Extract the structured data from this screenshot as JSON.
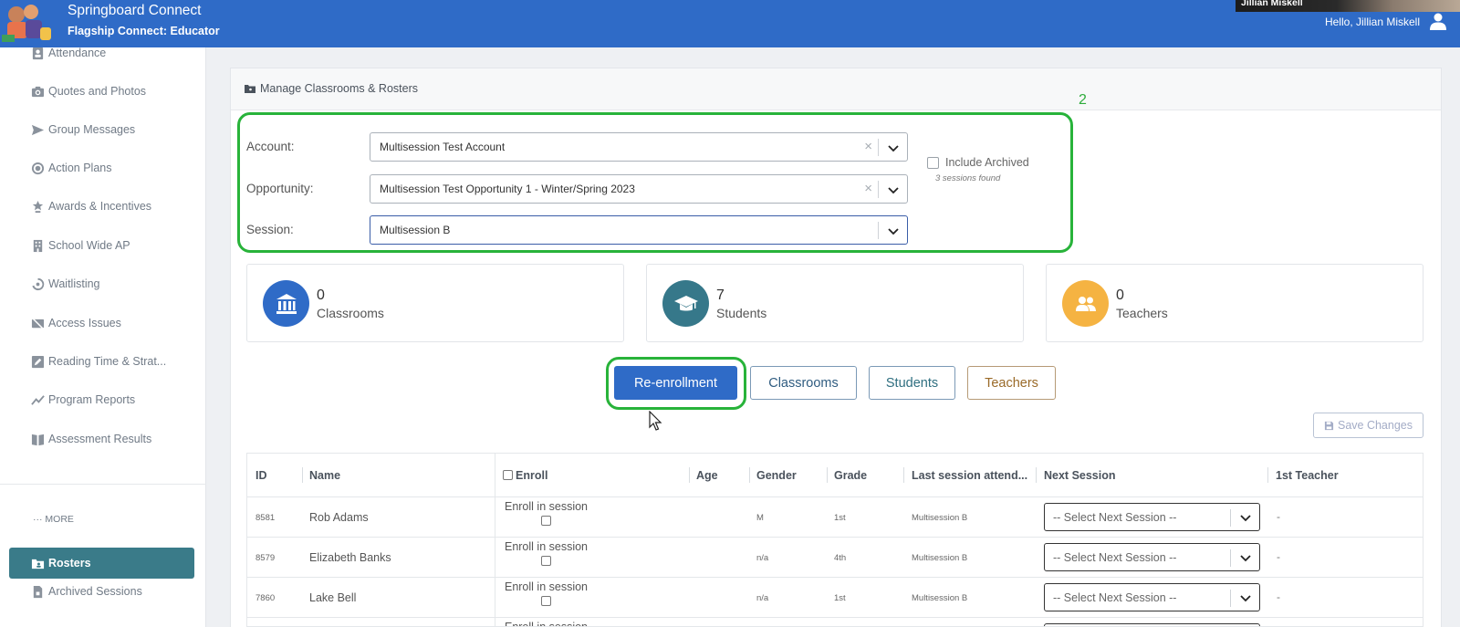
{
  "header": {
    "app_title": "Springboard Connect",
    "app_subtitle": "Flagship Connect: Educator",
    "greeting": "Hello, Jillian Miskell",
    "video_participant": "Jillian Miskell"
  },
  "sidebar": {
    "items": [
      {
        "label": "Attendance",
        "icon": "attendance-icon"
      },
      {
        "label": "Quotes and Photos",
        "icon": "camera-icon"
      },
      {
        "label": "Group Messages",
        "icon": "send-icon"
      },
      {
        "label": "Action Plans",
        "icon": "target-icon"
      },
      {
        "label": "Awards & Incentives",
        "icon": "award-icon"
      },
      {
        "label": "School Wide AP",
        "icon": "building-icon"
      },
      {
        "label": "Waitlisting",
        "icon": "waitlist-icon"
      },
      {
        "label": "Access Issues",
        "icon": "access-icon"
      },
      {
        "label": "Reading Time & Strat...",
        "icon": "edit-icon"
      },
      {
        "label": "Program Reports",
        "icon": "chart-line-icon"
      },
      {
        "label": "Assessment Results",
        "icon": "book-icon"
      }
    ],
    "more_label": "··· MORE",
    "active_item": "Rosters",
    "archived_sessions": "Archived Sessions"
  },
  "card": {
    "title": "Manage Classrooms & Rosters",
    "annotation_number": "2"
  },
  "filters": {
    "account_label": "Account:",
    "account_value": "Multisession Test Account",
    "opportunity_label": "Opportunity:",
    "opportunity_value": "Multisession Test Opportunity 1 - Winter/Spring 2023",
    "session_label": "Session:",
    "session_value": "Multisession B",
    "include_archived_label": "Include Archived",
    "sessions_found": "3 sessions found"
  },
  "stats": {
    "classrooms": {
      "count": "0",
      "label": "Classrooms",
      "color": "#2f6bc7"
    },
    "students": {
      "count": "7",
      "label": "Students",
      "color": "#36788a"
    },
    "teachers": {
      "count": "0",
      "label": "Teachers",
      "color": "#f5b342"
    }
  },
  "tabs": {
    "reenrollment": "Re-enrollment",
    "classrooms": "Classrooms",
    "students": "Students",
    "teachers": "Teachers"
  },
  "save_button": "Save Changes",
  "table": {
    "headers": {
      "id": "ID",
      "name": "Name",
      "enroll": "Enroll",
      "age": "Age",
      "gender": "Gender",
      "grade": "Grade",
      "last_session": "Last session attend...",
      "next_session": "Next Session",
      "first_teacher": "1st Teacher"
    },
    "enroll_cell_label": "Enroll in session",
    "next_session_placeholder": "-- Select Next Session --",
    "teacher_placeholder": "-",
    "rows": [
      {
        "id": "8581",
        "name": "Rob Adams",
        "age": "",
        "gender": "M",
        "grade": "1st",
        "last_session": "Multisession B"
      },
      {
        "id": "8579",
        "name": "Elizabeth Banks",
        "age": "",
        "gender": "n/a",
        "grade": "4th",
        "last_session": "Multisession B"
      },
      {
        "id": "7860",
        "name": "Lake Bell",
        "age": "",
        "gender": "n/a",
        "grade": "1st",
        "last_session": "Multisession B"
      }
    ]
  },
  "colors": {
    "brand_blue": "#2f6bc7",
    "teal": "#3a7b89",
    "annotation_green": "#28b33a",
    "teachers_text": "#9a6a28"
  }
}
